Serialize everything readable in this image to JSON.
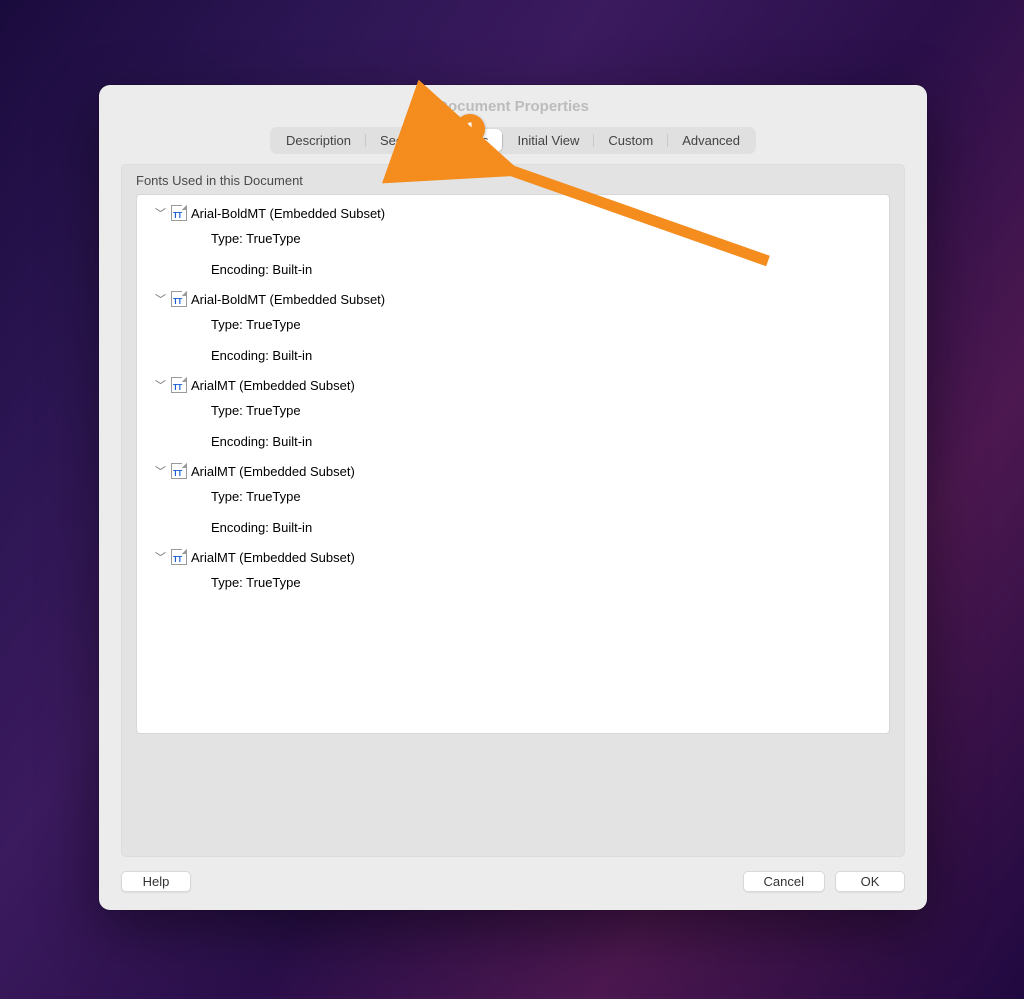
{
  "dialog": {
    "title": "Document Properties",
    "tabs": [
      "Description",
      "Security",
      "Fonts",
      "Initial View",
      "Custom",
      "Advanced"
    ],
    "active_tab": "Fonts",
    "group_label": "Fonts Used in this Document",
    "help_label": "Help",
    "cancel_label": "Cancel",
    "ok_label": "OK"
  },
  "fonts": [
    {
      "name": "Arial-BoldMT (Embedded Subset)",
      "type_label": "Type: TrueType",
      "encoding_label": "Encoding: Built-in"
    },
    {
      "name": "Arial-BoldMT (Embedded Subset)",
      "type_label": "Type: TrueType",
      "encoding_label": "Encoding: Built-in"
    },
    {
      "name": "ArialMT (Embedded Subset)",
      "type_label": "Type: TrueType",
      "encoding_label": "Encoding: Built-in"
    },
    {
      "name": "ArialMT (Embedded Subset)",
      "type_label": "Type: TrueType",
      "encoding_label": "Encoding: Built-in"
    },
    {
      "name": "ArialMT (Embedded Subset)",
      "type_label": "Type: TrueType",
      "encoding_label": ""
    }
  ],
  "annotation": {
    "badge_number": "1",
    "color": "#f48c1e"
  }
}
